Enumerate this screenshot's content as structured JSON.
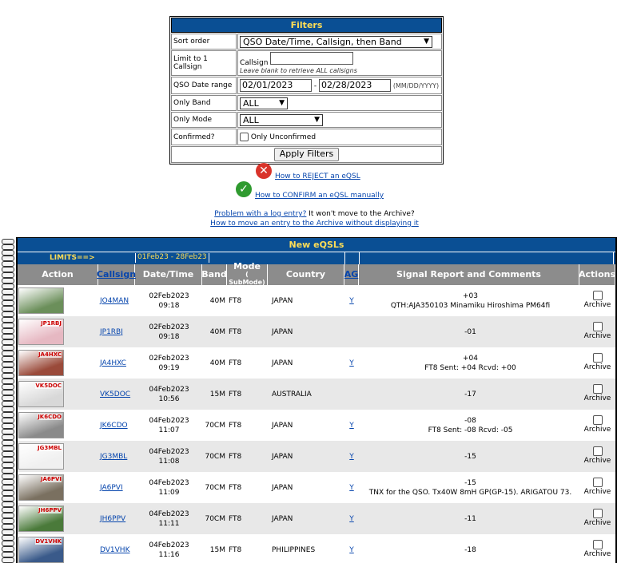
{
  "filters": {
    "title": "Filters",
    "sort_label": "Sort order",
    "sort_value": "QSO Date/Time, Callsign, then Band",
    "callsign_label": "Limit to 1 Callsign",
    "callsign_field_label": "Callsign",
    "callsign_value": "",
    "callsign_hint": "Leave blank to retrieve ALL callsigns",
    "date_label": "QSO Date range",
    "date_from": "02/01/2023",
    "date_sep": "-",
    "date_to": "02/28/2023",
    "date_fmt": "(MM/DD/YYYY)",
    "band_label": "Only Band",
    "band_value": "ALL",
    "mode_label": "Only Mode",
    "mode_value": "ALL",
    "confirmed_label": "Confirmed?",
    "unconfirmed_label": "Only Unconfirmed",
    "apply_label": "Apply Filters"
  },
  "help": {
    "reject": "How to REJECT an eQSL",
    "confirm": "How to CONFIRM an eQSL manually",
    "problem_link": "Problem with a log entry?",
    "problem_text": " It won't move to the Archive?",
    "move_link": "How to move an entry to the Archive without displaying it"
  },
  "qsl": {
    "title": "New eQSLs",
    "limits_label": "LIMITS==>",
    "limits_range": "01Feb23 - 28Feb23",
    "headers": {
      "action": "Action",
      "callsign": "Callsign",
      "datetime": "Date/Time",
      "band": "Band",
      "mode1": "Mode",
      "mode2": "( SubMode)",
      "country": "Country",
      "ag": "AG",
      "signal": "Signal Report and Comments",
      "actions": "Actions"
    },
    "archive_label": "Archive",
    "rows": [
      {
        "call": "JO4MAN",
        "date": "02Feb2023",
        "time": "09:18",
        "band": "40M",
        "mode": "FT8",
        "country": "JAPAN",
        "ag": "Y",
        "sig": "+03",
        "comment": "QTH:AJA350103 Minamiku Hiroshima PM64fi",
        "thumb_text": "",
        "thumb_color": "#6b8f5a"
      },
      {
        "call": "JP1RBJ",
        "date": "02Feb2023",
        "time": "09:18",
        "band": "40M",
        "mode": "FT8",
        "country": "JAPAN",
        "ag": "",
        "sig": "-01",
        "comment": "",
        "thumb_text": "JP1RBJ",
        "thumb_color": "#e6b8c2"
      },
      {
        "call": "JA4HXC",
        "date": "02Feb2023",
        "time": "09:19",
        "band": "40M",
        "mode": "FT8",
        "country": "JAPAN",
        "ag": "Y",
        "sig": "+04",
        "comment": "FT8 Sent: +04 Rcvd: +00",
        "thumb_text": "JA4HXC",
        "thumb_color": "#9a4a3a"
      },
      {
        "call": "VK5DOC",
        "date": "04Feb2023",
        "time": "10:56",
        "band": "15M",
        "mode": "FT8",
        "country": "AUSTRALIA",
        "ag": "",
        "sig": "-17",
        "comment": "",
        "thumb_text": "VK5DOC",
        "thumb_color": "#d8d8d8"
      },
      {
        "call": "JK6CDO",
        "date": "04Feb2023",
        "time": "11:07",
        "band": "70CM",
        "mode": "FT8",
        "country": "JAPAN",
        "ag": "Y",
        "sig": "-08",
        "comment": "FT8 Sent: -08 Rcvd: -05",
        "thumb_text": "JK6CDO",
        "thumb_color": "#8a8a8a"
      },
      {
        "call": "JG3MBL",
        "date": "04Feb2023",
        "time": "11:08",
        "band": "70CM",
        "mode": "FT8",
        "country": "JAPAN",
        "ag": "Y",
        "sig": "-15",
        "comment": "",
        "thumb_text": "JG3MBL",
        "thumb_color": "#f0f0f0"
      },
      {
        "call": "JA6PVI",
        "date": "04Feb2023",
        "time": "11:09",
        "band": "70CM",
        "mode": "FT8",
        "country": "JAPAN",
        "ag": "Y",
        "sig": "-15",
        "comment": "TNX for the QSO. Tx40W 8mH GP(GP-15). ARIGATOU 73.",
        "thumb_text": "JA6PVI",
        "thumb_color": "#7a7060"
      },
      {
        "call": "JH6PPV",
        "date": "04Feb2023",
        "time": "11:11",
        "band": "70CM",
        "mode": "FT8",
        "country": "JAPAN",
        "ag": "Y",
        "sig": "-11",
        "comment": "",
        "thumb_text": "JH6PPV",
        "thumb_color": "#4a7a3a"
      },
      {
        "call": "DV1VHK",
        "date": "04Feb2023",
        "time": "11:16",
        "band": "15M",
        "mode": "FT8",
        "country": "PHILIPPINES",
        "ag": "Y",
        "sig": "-18",
        "comment": "",
        "thumb_text": "DV1VHK",
        "thumb_color": "#3a5a8a"
      }
    ]
  }
}
